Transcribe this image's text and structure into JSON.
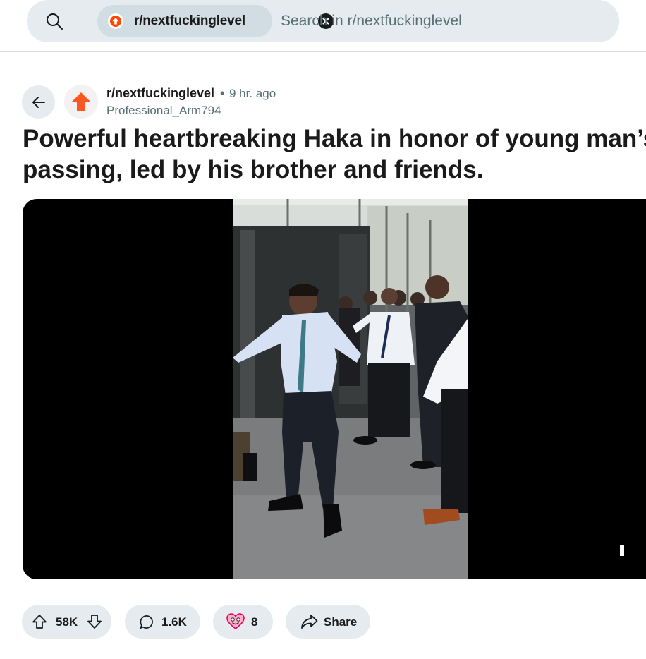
{
  "search": {
    "subreddit_chip": "r/nextfuckinglevel",
    "placeholder": "Search in r/nextfuckinglevel"
  },
  "post": {
    "subreddit": "r/nextfuckinglevel",
    "separator": "•",
    "time_ago": "9 hr. ago",
    "author": "Professional_Arm794",
    "title_line1": "Powerful heartbreaking Haka in honor of young man’s",
    "title_line2": "passing, led by his brother and friends."
  },
  "actions": {
    "votes": "58K",
    "comments": "1.6K",
    "awards": "8",
    "share": "Share"
  },
  "colors": {
    "accent": "#ff4500",
    "chip_bg": "#d1dde3",
    "button_bg": "#e5ebee",
    "muted_text": "#576f76"
  },
  "icons": [
    "search-icon",
    "upvote-icon",
    "close-icon",
    "back-arrow-icon",
    "subreddit-avatar-icon",
    "downvote-icon",
    "comment-icon",
    "award-icon",
    "share-icon"
  ]
}
